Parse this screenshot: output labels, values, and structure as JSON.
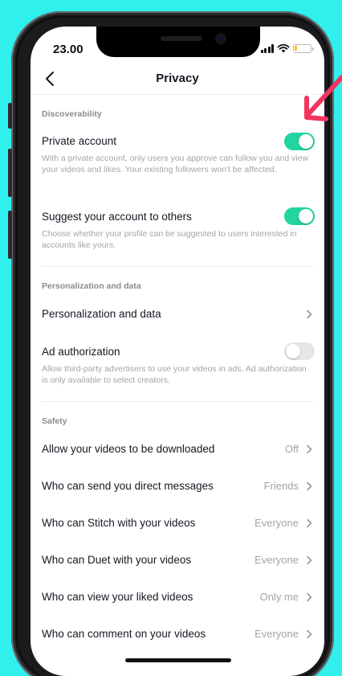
{
  "status_bar": {
    "time": "23.00"
  },
  "navbar": {
    "title": "Privacy"
  },
  "sections": {
    "discoverability": {
      "header": "Discoverability"
    },
    "personalization": {
      "header": "Personalization and data"
    },
    "safety": {
      "header": "Safety"
    }
  },
  "private_account": {
    "title": "Private account",
    "description": "With a private account, only users you approve can follow you and view your videos and likes. Your existing followers won't be affected.",
    "enabled": true
  },
  "suggest_account": {
    "title": "Suggest your account to others",
    "description": "Choose whether your profile can be suggested to users interested in accounts like yours.",
    "enabled": true
  },
  "personalization_data": {
    "title": "Personalization and data"
  },
  "ad_authorization": {
    "title": "Ad authorization",
    "description": "Allow third-party advertisers to use your videos in ads. Ad authorization is only available to select creators.",
    "enabled": false
  },
  "safety_rows": [
    {
      "title": "Allow your videos to be downloaded",
      "value": "Off"
    },
    {
      "title": "Who can send you direct messages",
      "value": "Friends"
    },
    {
      "title": "Who can Stitch with your videos",
      "value": "Everyone"
    },
    {
      "title": "Who can Duet with your videos",
      "value": "Everyone"
    },
    {
      "title": "Who can view your liked videos",
      "value": "Only me"
    },
    {
      "title": "Who can comment on your videos",
      "value": "Everyone"
    }
  ],
  "colors": {
    "background": "#2ff0ec",
    "toggle_on": "#20d5a0",
    "toggle_off": "#e6e6e9",
    "annotation_arrow": "#f2355f"
  },
  "icons": {
    "back": "chevron-left-icon",
    "row_chevron": "chevron-right-icon",
    "annotation": "arrow-icon"
  }
}
